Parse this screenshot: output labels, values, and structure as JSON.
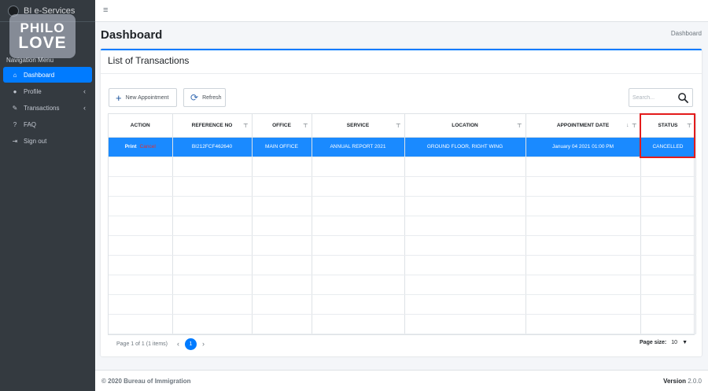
{
  "app": {
    "brand": "BI e-Services",
    "watermark_line1": "PHILO",
    "watermark_line2": "LOVE"
  },
  "sidebar": {
    "header": "Navigation Menu",
    "items": [
      {
        "label": "Dashboard",
        "icon": "home-icon",
        "glyph": "⌂",
        "active": true,
        "caret": ""
      },
      {
        "label": "Profile",
        "icon": "user-icon",
        "glyph": "●",
        "active": false,
        "caret": "‹"
      },
      {
        "label": "Transactions",
        "icon": "edit-icon",
        "glyph": "✎",
        "active": false,
        "caret": "‹"
      },
      {
        "label": "FAQ",
        "icon": "question-icon",
        "glyph": "?",
        "active": false,
        "caret": ""
      },
      {
        "label": "Sign out",
        "icon": "sign-out-icon",
        "glyph": "⇥",
        "active": false,
        "caret": ""
      }
    ]
  },
  "header": {
    "title": "Dashboard",
    "breadcrumb": "Dashboard"
  },
  "card": {
    "title": "List of Transactions",
    "new_button": "New Appointment",
    "refresh_button": "Refresh",
    "search_placeholder": "Search..."
  },
  "table": {
    "columns": [
      "ACTION",
      "REFERENCE NO",
      "OFFICE",
      "SERVICE",
      "LOCATION",
      "APPOINTMENT DATE",
      "STATUS"
    ],
    "rows": [
      {
        "action_print": "Print",
        "action_cancel": "Cancel",
        "reference_no": "BI212FCF462640",
        "office": "MAIN OFFICE",
        "service": "ANNUAL REPORT 2021",
        "location": "GROUND FLOOR, RIGHT WING",
        "appointment_date": "January 04 2021 01:00 PM",
        "status": "CANCELLED"
      }
    ],
    "empty_rows": 9
  },
  "pager": {
    "info": "Page 1 of 1 (1 items)",
    "current_page": "1",
    "page_size_label": "Page size:",
    "page_size": "10"
  },
  "footer": {
    "copyright": "© 2020 Bureau of Immigration",
    "version_label": "Version",
    "version": "2.0.0"
  },
  "colors": {
    "accent": "#007bff",
    "sidebar": "#343a40",
    "selected_row": "#1a8aff",
    "highlight": "#e31b1b"
  }
}
